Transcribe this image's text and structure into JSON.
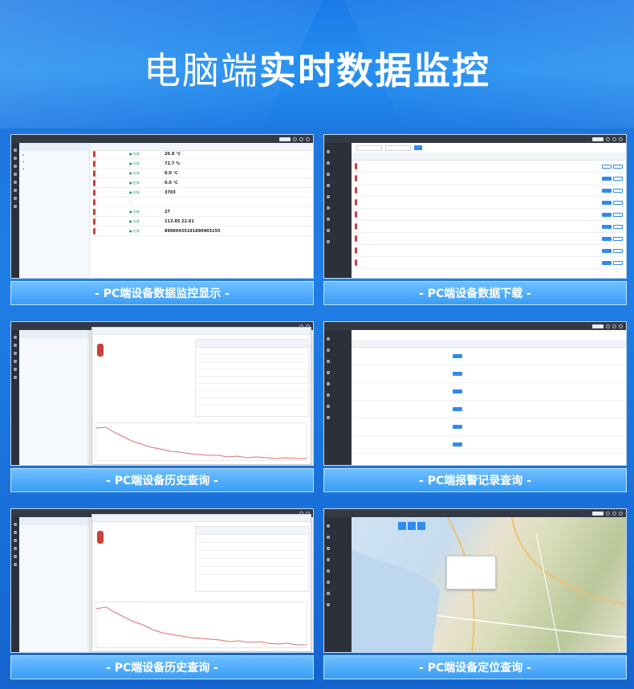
{
  "hero": {
    "title_light": "电脑端",
    "title_bold": "实时数据监控"
  },
  "panels": [
    {
      "caption": "- PC端设备数据监控显示 -"
    },
    {
      "caption": "- PC端设备数据下载 -"
    },
    {
      "caption": "- PC端设备历史查询 -"
    },
    {
      "caption": "- PC端报警记录查询 -"
    },
    {
      "caption": "- PC端设备历史查询 -"
    },
    {
      "caption": "- PC端设备定位查询 -"
    }
  ],
  "monitor": {
    "readings": [
      "26.8",
      "72.7",
      "0.0",
      "0.0",
      "3703",
      "",
      "27",
      "113.85   22.61",
      "89060435191890403155"
    ],
    "values_suffix": [
      "℃",
      "%",
      "℃",
      "℃",
      "",
      "",
      "",
      "",
      ""
    ]
  },
  "colors": {
    "brand_blue": "#1b7fe0",
    "thermo_red": "#c8413b",
    "caption_blue": "#3a9df5"
  }
}
